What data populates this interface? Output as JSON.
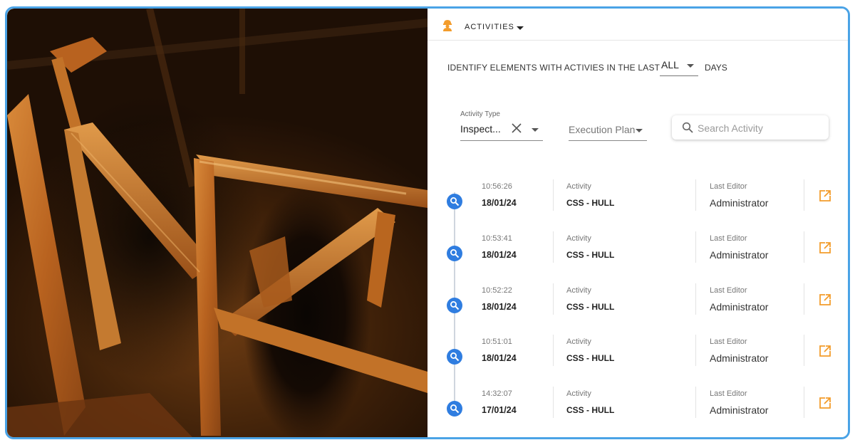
{
  "header": {
    "menu_label": "ACTIVITIES",
    "user_icon": "worker-icon"
  },
  "period": {
    "prefix": "IDENTIFY ELEMENTS WITH ACTIVIES IN THE LAST",
    "selected": "ALL",
    "suffix": "DAYS"
  },
  "filters": {
    "activity_type_label": "Activity Type",
    "activity_type_value": "Inspect...",
    "execution_plan_placeholder": "Execution Plan",
    "search_placeholder": "Search Activity"
  },
  "columns": {
    "activity": "Activity",
    "last_editor": "Last Editor"
  },
  "rows": [
    {
      "time": "10:56:26",
      "date": "18/01/24",
      "activity": "CSS - HULL",
      "editor": "Administrator"
    },
    {
      "time": "10:53:41",
      "date": "18/01/24",
      "activity": "CSS - HULL",
      "editor": "Administrator"
    },
    {
      "time": "10:52:22",
      "date": "18/01/24",
      "activity": "CSS - HULL",
      "editor": "Administrator"
    },
    {
      "time": "10:51:01",
      "date": "18/01/24",
      "activity": "CSS - HULL",
      "editor": "Administrator"
    },
    {
      "time": "14:32:07",
      "date": "17/01/24",
      "activity": "CSS - HULL",
      "editor": "Administrator"
    }
  ],
  "colors": {
    "accent_orange": "#f39c2b",
    "marker_blue": "#2f7de0",
    "frame_blue": "#4aa3e6"
  }
}
